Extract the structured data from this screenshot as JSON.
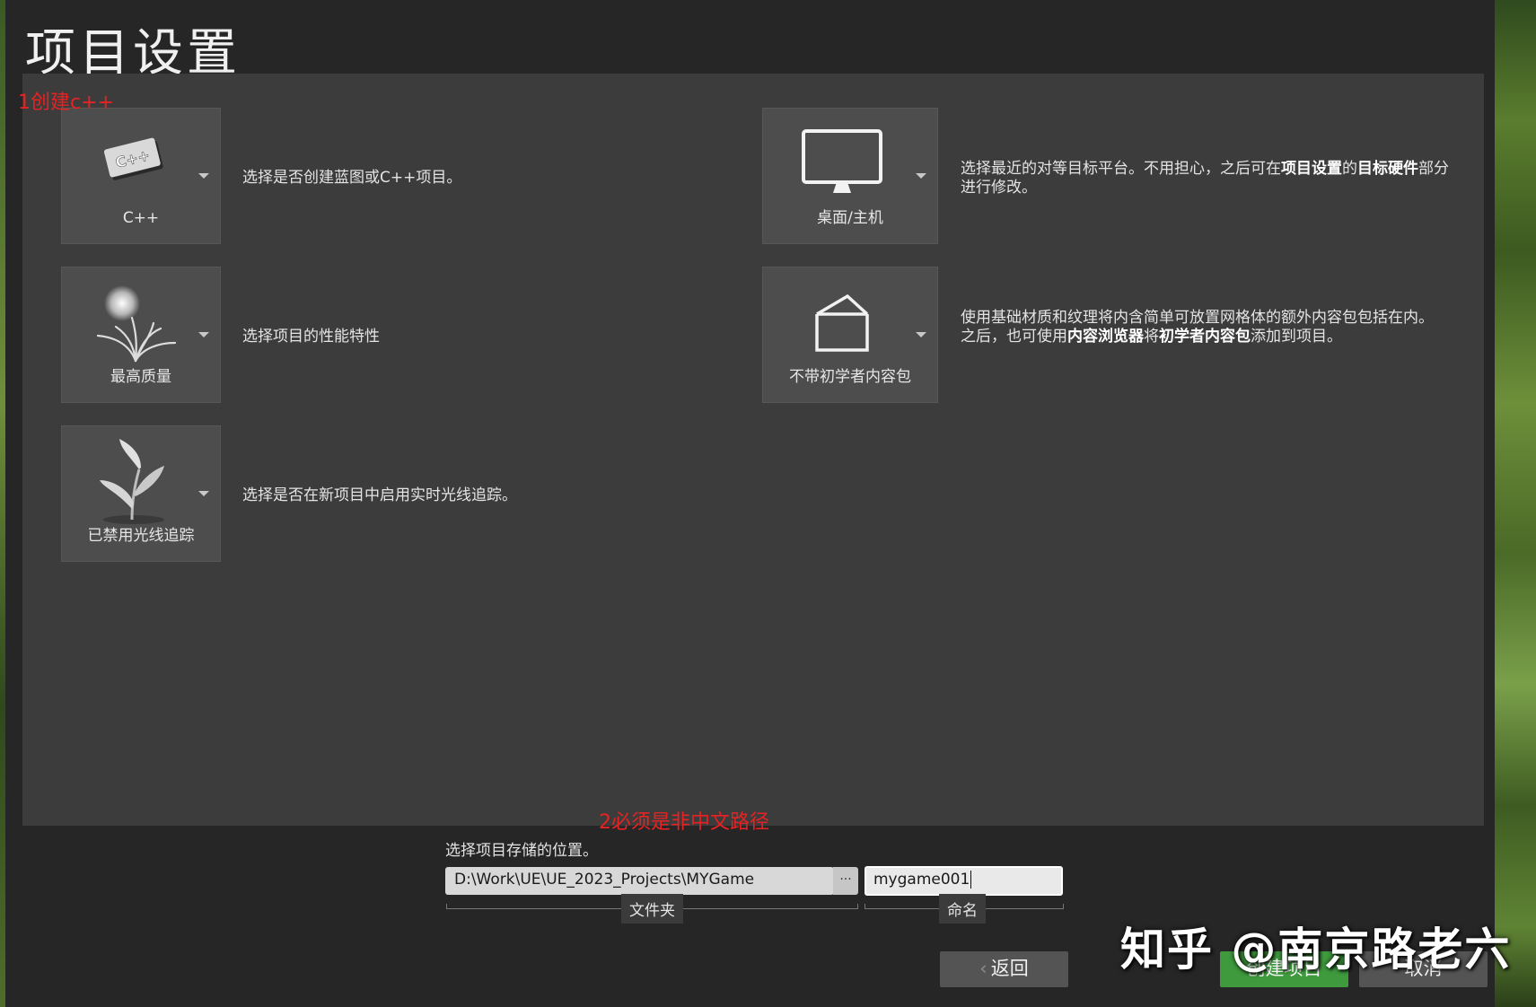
{
  "title": "项目设置",
  "annotations": {
    "note1": "1创建c++",
    "note2": "2必须是非中文路径"
  },
  "options": {
    "project_type": {
      "label": "C++",
      "description": "选择是否创建蓝图或C++项目。"
    },
    "quality": {
      "label": "最高质量",
      "description": "选择项目的性能特性"
    },
    "raytracing": {
      "label": "已禁用光线追踪",
      "description": "选择是否在新项目中启用实时光线追踪。"
    },
    "platform": {
      "label": "桌面/主机",
      "description_a": "选择最近的对等目标平台。不用担心，之后可在",
      "description_b": "项目设置",
      "description_c": "的",
      "description_d": "目标硬件",
      "description_e": "部分进行修改。"
    },
    "starter_content": {
      "label": "不带初学者内容包",
      "description_a": "使用基础材质和纹理将内含简单可放置网格体的额外内容包包括在内。",
      "description_b": "之后，也可使用",
      "description_c": "内容浏览器",
      "description_d": "将",
      "description_e": "初学者内容包",
      "description_f": "添加到项目。"
    }
  },
  "location": {
    "label": "选择项目存储的位置。",
    "path": "D:\\Work\\UE\\UE_2023_Projects\\MYGame",
    "browse": "···",
    "folder_label": "文件夹",
    "name": "mygame001",
    "name_label": "命名"
  },
  "buttons": {
    "back": "返回",
    "back_icon": "‹",
    "create": "创建项目",
    "cancel": "取消"
  },
  "watermark": "知乎 @南京路老六",
  "colors": {
    "accent_green": "#3f9a3e",
    "annotation_red": "#e82222"
  }
}
